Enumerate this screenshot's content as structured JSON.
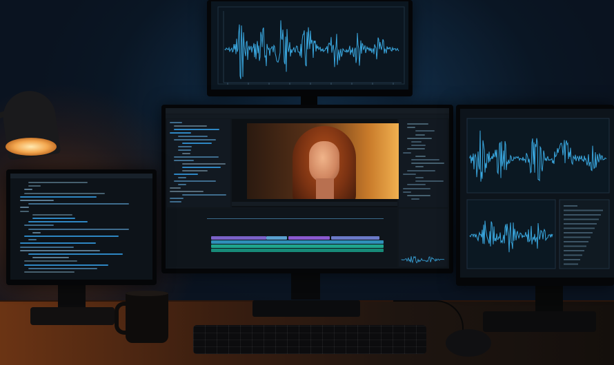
{
  "scene": {
    "description_free": true,
    "colors": {
      "accent": "#2e87c4",
      "waveform": "#3aa8e0",
      "lamp_light": "#f4a850",
      "teal_track": "#1fa58e",
      "purple_track": "#8a5ad0"
    }
  },
  "icons": [
    "lamp-icon",
    "mug-icon",
    "keyboard-icon",
    "mouse-icon"
  ],
  "chart_data": []
}
